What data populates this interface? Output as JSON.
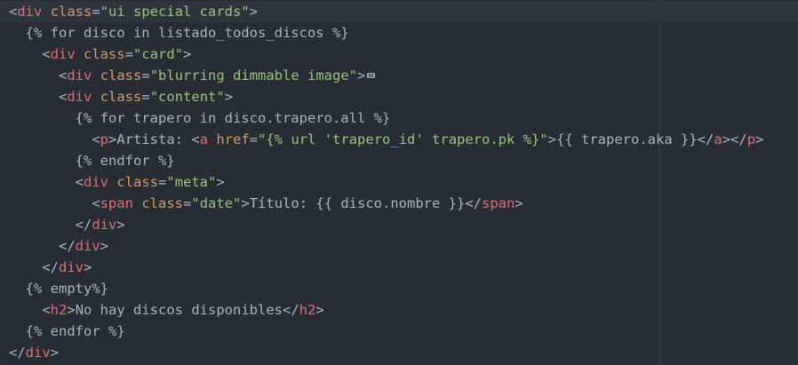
{
  "editor": {
    "colors": {
      "background": "#282c34",
      "active_line": "#2f343f",
      "tag": "#e06c75",
      "attribute": "#d19a66",
      "string": "#98c379",
      "text": "#abb2bf"
    },
    "fold_icon": "fold-ellipsis-icon",
    "lines": [
      {
        "tokens": [
          [
            "p",
            "<"
          ],
          [
            "tag",
            "div"
          ],
          [
            "text",
            " "
          ],
          [
            "attr",
            "class"
          ],
          [
            "p",
            "="
          ],
          [
            "str",
            "\"ui special cards\""
          ],
          [
            "p",
            ">"
          ]
        ]
      },
      {
        "tokens": [
          [
            "text",
            "  {% for disco in listado_todos_discos %}"
          ]
        ]
      },
      {
        "tokens": [
          [
            "text",
            "    "
          ],
          [
            "p",
            "<"
          ],
          [
            "tag",
            "div"
          ],
          [
            "text",
            " "
          ],
          [
            "attr",
            "class"
          ],
          [
            "p",
            "="
          ],
          [
            "str",
            "\"card\""
          ],
          [
            "p",
            ">"
          ]
        ]
      },
      {
        "tokens": [
          [
            "text",
            "      "
          ],
          [
            "p",
            "<"
          ],
          [
            "tag",
            "div"
          ],
          [
            "text",
            " "
          ],
          [
            "attr",
            "class"
          ],
          [
            "p",
            "="
          ],
          [
            "str",
            "\"blurring dimmable image\""
          ],
          [
            "p",
            ">"
          ]
        ],
        "folded": true
      },
      {
        "tokens": [
          [
            "text",
            "      "
          ],
          [
            "p",
            "<"
          ],
          [
            "tag",
            "div"
          ],
          [
            "text",
            " "
          ],
          [
            "attr",
            "class"
          ],
          [
            "p",
            "="
          ],
          [
            "str",
            "\"content\""
          ],
          [
            "p",
            ">"
          ]
        ]
      },
      {
        "tokens": [
          [
            "text",
            "        {% for trapero in disco.trapero.all %}"
          ]
        ]
      },
      {
        "tokens": [
          [
            "text",
            "          "
          ],
          [
            "p",
            "<"
          ],
          [
            "tag",
            "p"
          ],
          [
            "p",
            ">"
          ],
          [
            "text",
            "Artista: "
          ],
          [
            "p",
            "<"
          ],
          [
            "tag",
            "a"
          ],
          [
            "text",
            " "
          ],
          [
            "attr",
            "href"
          ],
          [
            "p",
            "="
          ],
          [
            "str",
            "\"{% url 'trapero_id' trapero.pk %}\""
          ],
          [
            "p",
            ">"
          ],
          [
            "text",
            "{{ trapero.aka }}"
          ],
          [
            "p",
            "</"
          ],
          [
            "tag",
            "a"
          ],
          [
            "p",
            "></"
          ],
          [
            "tag",
            "p"
          ],
          [
            "p",
            ">"
          ]
        ]
      },
      {
        "tokens": [
          [
            "text",
            "        {% endfor %}"
          ]
        ]
      },
      {
        "tokens": [
          [
            "text",
            "        "
          ],
          [
            "p",
            "<"
          ],
          [
            "tag",
            "div"
          ],
          [
            "text",
            " "
          ],
          [
            "attr",
            "class"
          ],
          [
            "p",
            "="
          ],
          [
            "str",
            "\"meta\""
          ],
          [
            "p",
            ">"
          ]
        ]
      },
      {
        "tokens": [
          [
            "text",
            "          "
          ],
          [
            "p",
            "<"
          ],
          [
            "tag",
            "span"
          ],
          [
            "text",
            " "
          ],
          [
            "attr",
            "class"
          ],
          [
            "p",
            "="
          ],
          [
            "str",
            "\"date\""
          ],
          [
            "p",
            ">"
          ],
          [
            "text",
            "Título: {{ disco.nombre }}"
          ],
          [
            "p",
            "</"
          ],
          [
            "tag",
            "span"
          ],
          [
            "p",
            ">"
          ]
        ]
      },
      {
        "tokens": [
          [
            "text",
            "        "
          ],
          [
            "p",
            "</"
          ],
          [
            "tag",
            "div"
          ],
          [
            "p",
            ">"
          ]
        ]
      },
      {
        "tokens": [
          [
            "text",
            "      "
          ],
          [
            "p",
            "</"
          ],
          [
            "tag",
            "div"
          ],
          [
            "p",
            ">"
          ]
        ]
      },
      {
        "tokens": [
          [
            "text",
            "    "
          ],
          [
            "p",
            "</"
          ],
          [
            "tag",
            "div"
          ],
          [
            "p",
            ">"
          ]
        ]
      },
      {
        "tokens": [
          [
            "text",
            "  {% empty%}"
          ]
        ]
      },
      {
        "tokens": [
          [
            "text",
            "    "
          ],
          [
            "p",
            "<"
          ],
          [
            "tag",
            "h2"
          ],
          [
            "p",
            ">"
          ],
          [
            "text",
            "No hay discos disponibles"
          ],
          [
            "p",
            "</"
          ],
          [
            "tag",
            "h2"
          ],
          [
            "p",
            ">"
          ]
        ]
      },
      {
        "tokens": [
          [
            "text",
            "  {% endfor %}"
          ]
        ]
      },
      {
        "tokens": [
          [
            "p",
            "</"
          ],
          [
            "tag",
            "div"
          ],
          [
            "p",
            ">"
          ]
        ]
      }
    ]
  }
}
